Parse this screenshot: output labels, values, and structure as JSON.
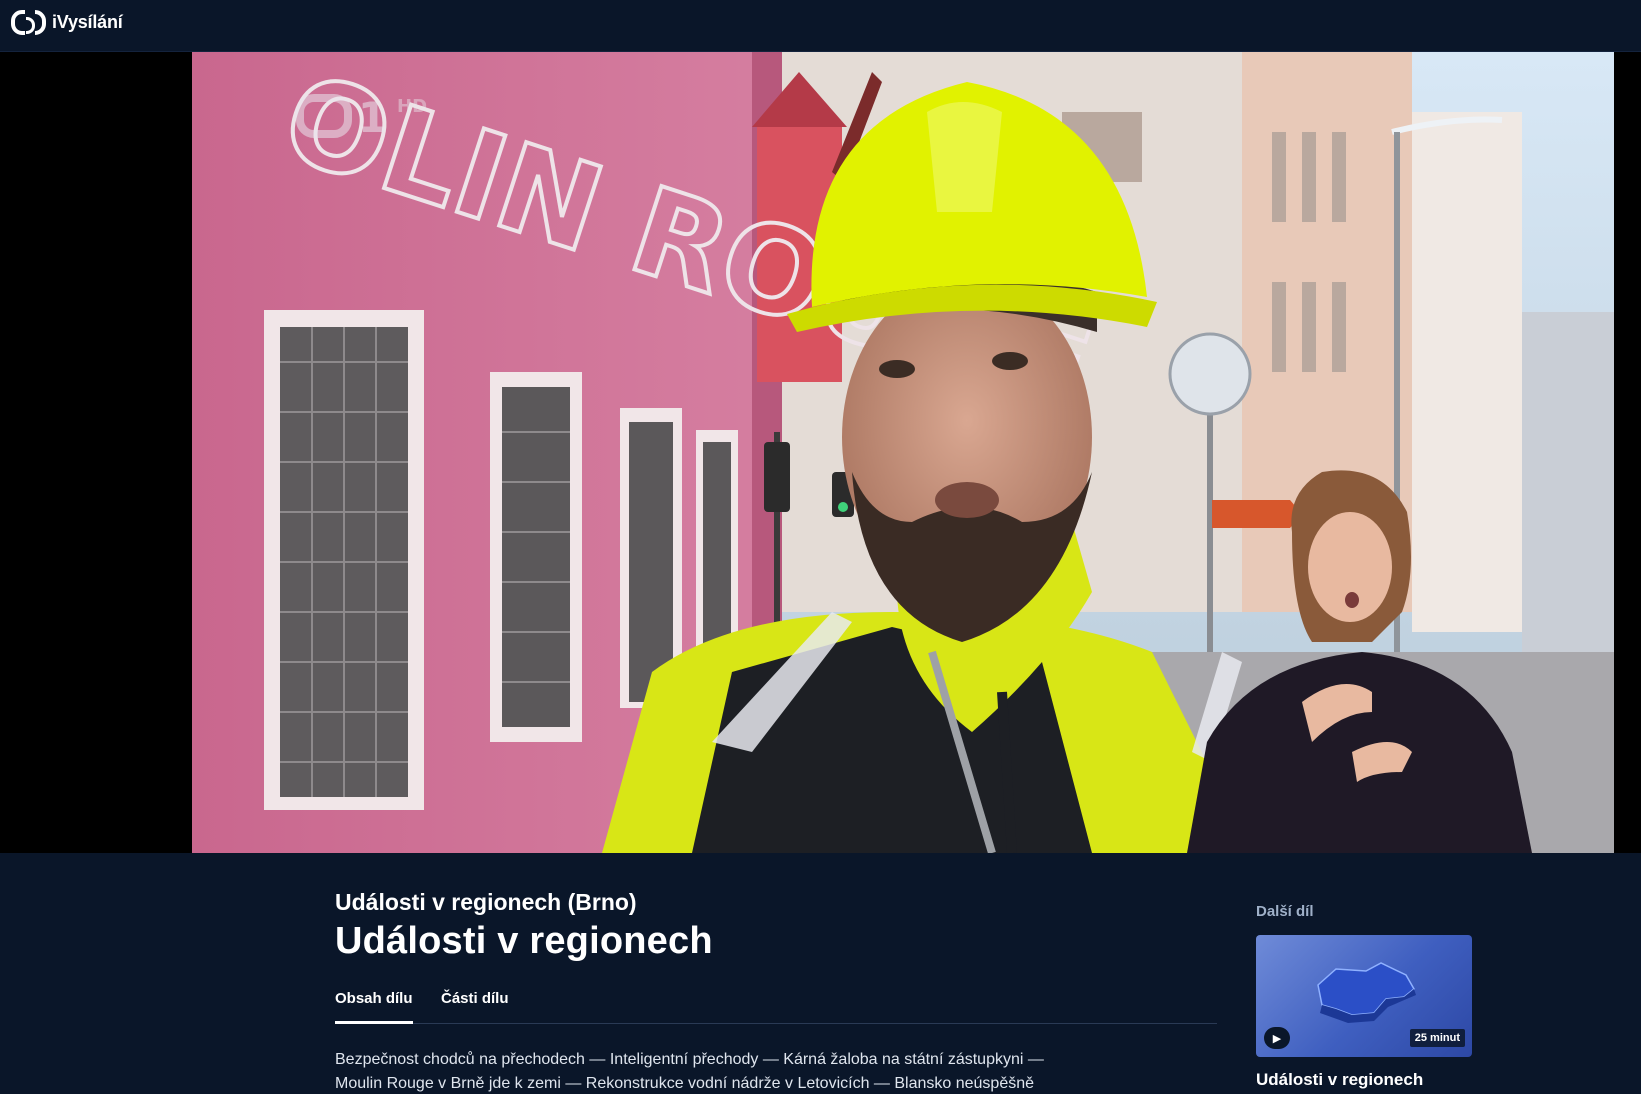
{
  "header": {
    "logo_text": "iVysílání"
  },
  "player": {
    "channel_logo": "1",
    "channel_hd": "HD",
    "sign_text": "OLIN ROUGE"
  },
  "episode": {
    "show_title": "Události v regionech (Brno)",
    "title": "Události v regionech",
    "tabs": [
      {
        "label": "Obsah dílu",
        "active": true
      },
      {
        "label": "Části dílu",
        "active": false
      }
    ],
    "description": "Bezpečnost chodců na přechodech — Inteligentní přechody — Kárná žaloba na státní zástupkyni — Moulin Rouge v Brně jde k zemi — Rekonstrukce vodní nádrže v Letovicích — Blansko neúspěšně"
  },
  "next": {
    "label": "Další díl",
    "duration": "25 minut",
    "title": "Události v regionech"
  },
  "colors": {
    "background": "#0a1629",
    "building": "#c9678e",
    "helmet": "#e1f200"
  }
}
